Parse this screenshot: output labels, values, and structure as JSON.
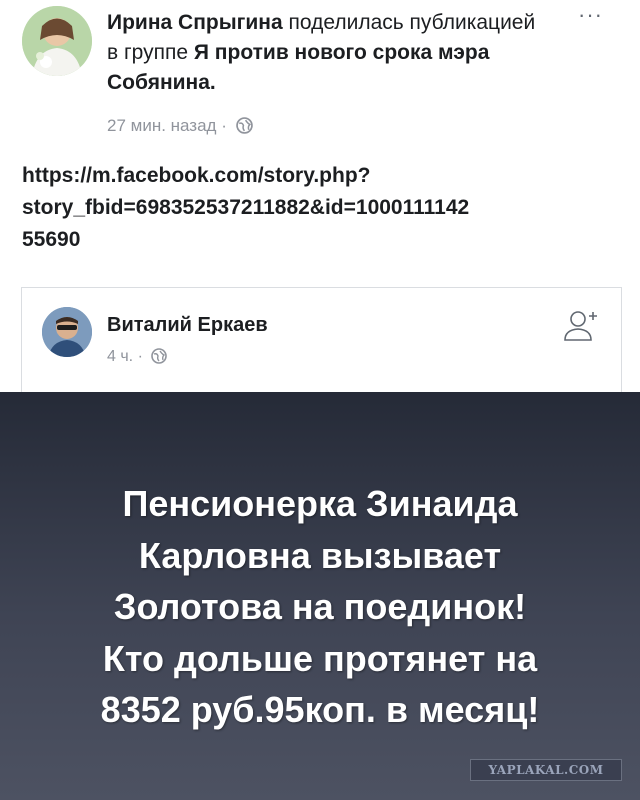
{
  "post": {
    "author": "Ирина Спрыгина",
    "action_text": "поделилась публикацией",
    "in_group_text": "в группе",
    "group_name": "Я против нового срока мэра Собянина.",
    "time": "27 мин. назад",
    "separator": "·",
    "privacy_icon": "globe-icon",
    "more_label": "···",
    "text_lines": [
      "https://m.facebook.com/story.php?",
      "story_fbid=698352537211882&id=1000111142",
      "55690"
    ]
  },
  "shared_card": {
    "author": "Виталий Еркаев",
    "time": "4 ч.",
    "separator": "·",
    "privacy_icon": "globe-icon",
    "add_friend_icon": "add-friend-icon"
  },
  "banner": {
    "lines": [
      "Пенсионерка Зинаида",
      "Карловна вызывает",
      "Золотова на поединок!",
      "Кто дольше протянет на",
      "8352 руб.95коп. в месяц!"
    ],
    "background_top": "#252a37",
    "background_bottom": "#4d5262",
    "watermark": "YAPLAKAL.COM"
  },
  "colors": {
    "text_primary": "#1c1e21",
    "text_secondary": "#90949c",
    "card_border": "#dadde1"
  }
}
